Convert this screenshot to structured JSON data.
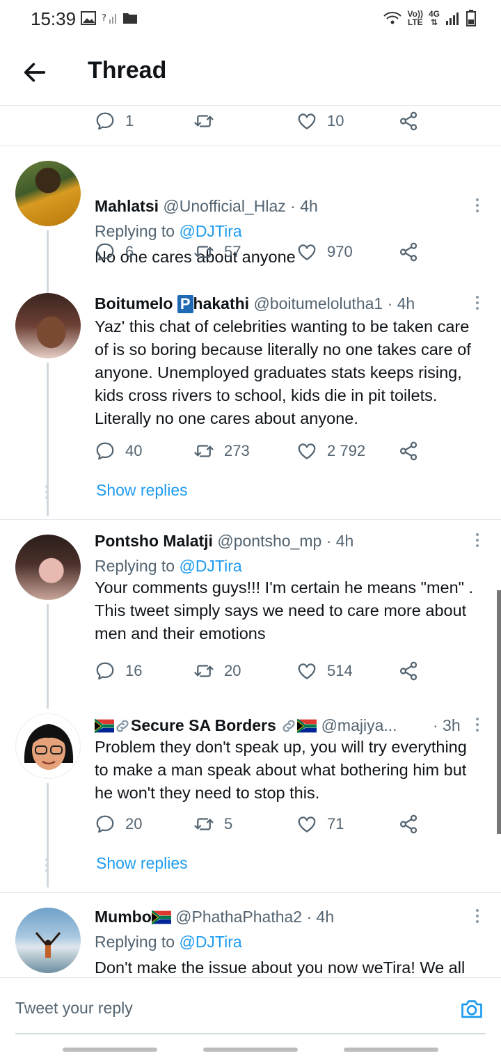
{
  "status_bar": {
    "time": "15:39",
    "volte": "Vo))",
    "lte": "LTE",
    "net": "4G"
  },
  "header": {
    "title": "Thread"
  },
  "top_actions": {
    "replies": "1",
    "retweets": "",
    "likes": "10"
  },
  "tweets": [
    {
      "name": "Mahlatsi",
      "handle": "@Unofficial_Hlaz",
      "time": "· 4h",
      "replying_prefix": "Replying to ",
      "replying_to": "@DJTira",
      "text": "No one cares about anyone",
      "replies": "6",
      "retweets": "57",
      "likes": "970"
    },
    {
      "name_prefix": "Boitumelo ",
      "name_badge": "P",
      "name_suffix": "hakathi",
      "handle": "@boitumelolutha1",
      "time": "· 4h",
      "text": "Yaz' this chat of celebrities wanting to be taken care of is so boring because literally no one takes care of anyone. Unemployed graduates stats keeps rising, kids cross rivers to school, kids die in pit toilets. Literally no one cares about anyone.",
      "replies": "40",
      "retweets": "273",
      "likes": "2 792",
      "show_replies": "Show replies"
    },
    {
      "name": "Pontsho Malatji",
      "handle": "@pontsho_mp",
      "time": "· 4h",
      "replying_prefix": "Replying to ",
      "replying_to": "@DJTira",
      "text": "Your comments guys!!! I'm certain he means \"men\" . This tweet simply says we need to care more about men and their emotions",
      "replies": "16",
      "retweets": "20",
      "likes": "514"
    },
    {
      "name": "Secure SA Borders",
      "handle": "@majiya...",
      "time": "· 3h",
      "text": "Problem they don't speak up, you will try everything to make a man speak about what bothering him but he won't they need to stop this.",
      "replies": "20",
      "retweets": "5",
      "likes": "71",
      "show_replies": "Show replies"
    },
    {
      "name": "Mumbo",
      "handle": "@PhathaPhatha2",
      "time": "· 4h",
      "replying_prefix": "Replying to ",
      "replying_to": "@DJTira",
      "text": "Don't make the issue about you now weTira! We all"
    }
  ],
  "reply_bar": {
    "placeholder": "Tweet your reply"
  },
  "icons": {
    "reply": "speech-bubble-icon",
    "retweet": "retweet-arrows-icon",
    "like": "heart-icon",
    "share": "share-icon",
    "back": "arrow-left-icon",
    "camera": "camera-icon"
  },
  "colors": {
    "accent": "#1d9bf0",
    "text": "#0f1419",
    "muted": "#536471",
    "divider": "#e1e8ed"
  }
}
